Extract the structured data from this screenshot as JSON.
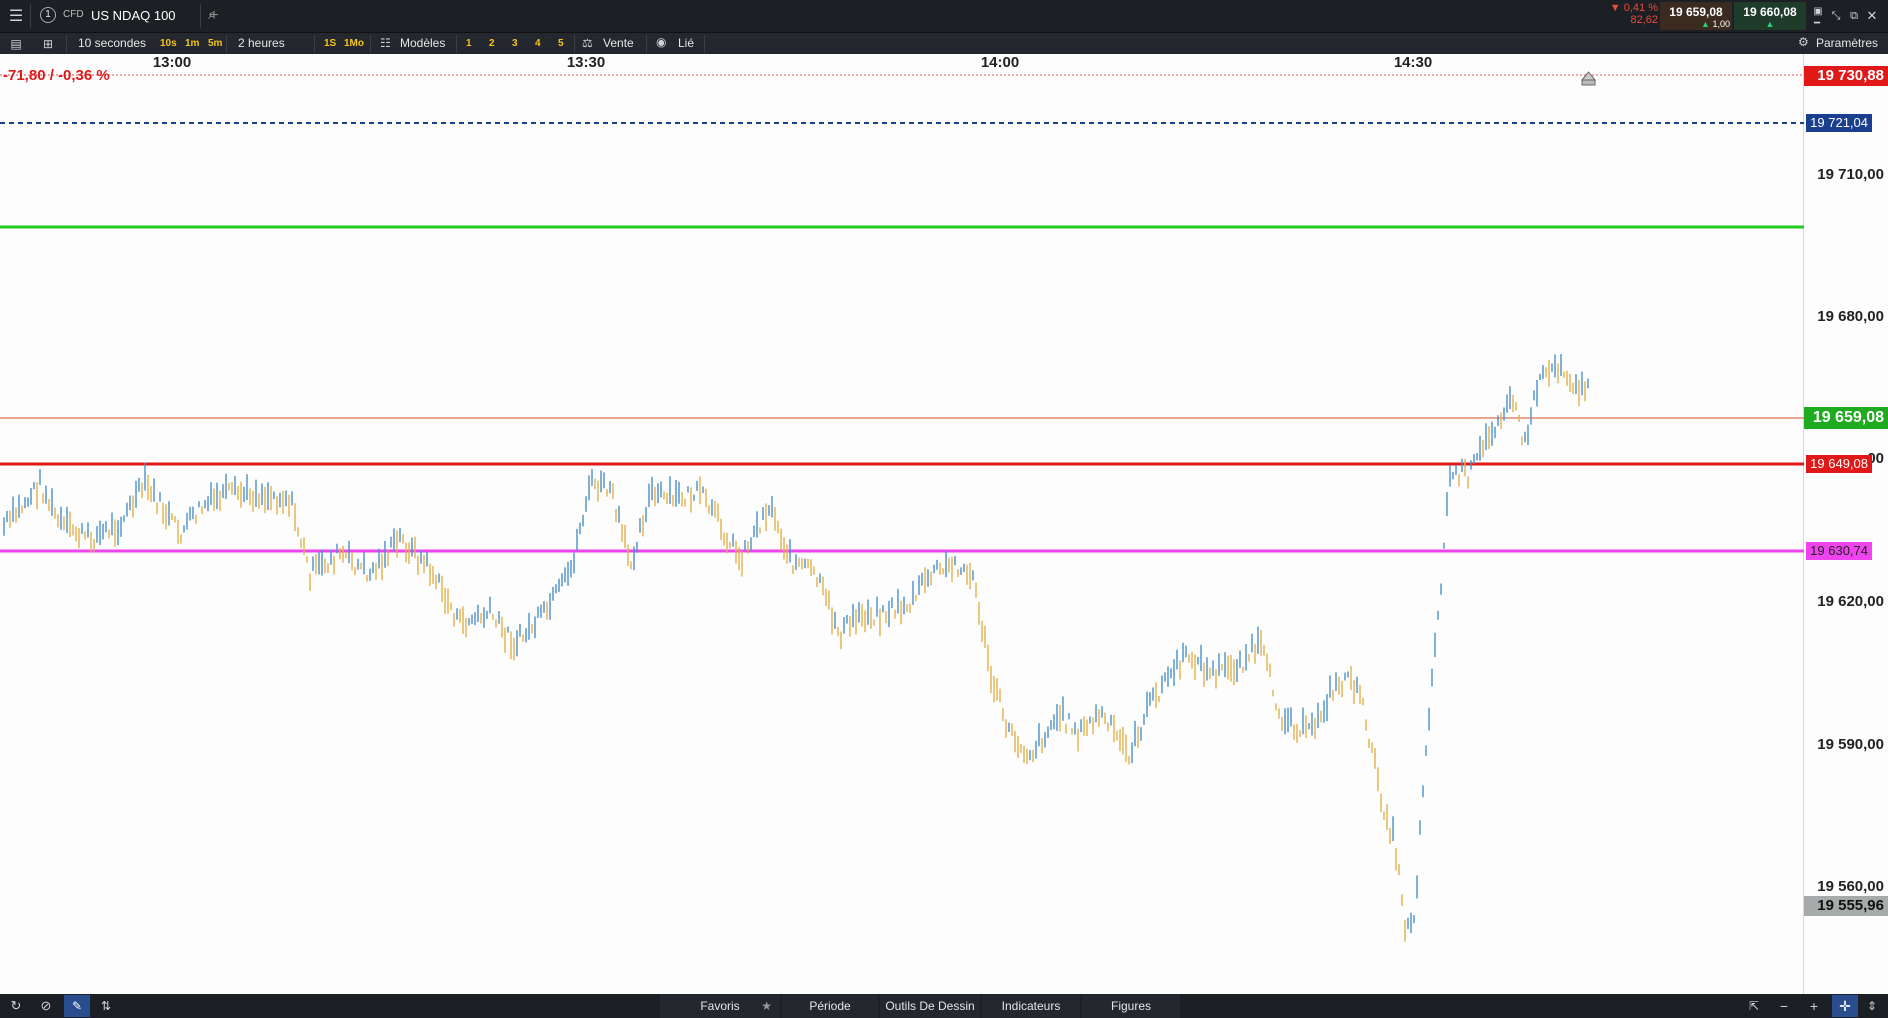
{
  "topbar": {
    "tab_index": "1",
    "instrument_type": "CFD",
    "instrument_name": "US NDAQ 100",
    "change_pct": "▼ 0,41 %",
    "change_pts": "82,62",
    "sell_price": "19 659,08",
    "spread": "1,00",
    "buy_price": "19 660,08"
  },
  "toolbar": {
    "interval": "10 secondes",
    "quick_intervals": [
      "10s",
      "1m",
      "5m"
    ],
    "range": "2 heures",
    "quick_ranges": [
      "1S",
      "1Mo"
    ],
    "templates": "Modèles",
    "slots": [
      "1",
      "2",
      "3",
      "4",
      "5"
    ],
    "trade_mode": "Vente",
    "linked": "Lié",
    "settings": "Paramètres"
  },
  "chart": {
    "change_readout": "-71,80 / -0,36 %",
    "time_labels": [
      "13:00",
      "13:30",
      "14:00",
      "14:30"
    ],
    "axis_labels": [
      "19 710,00",
      "19 680,00",
      "19 620,00",
      "19 590,00",
      "19 560,00"
    ],
    "hidden_label": "00",
    "tags": {
      "high": "19 730,88",
      "blue": "19 721,04",
      "last": "19 659,08",
      "red": "19 649,08",
      "magenta": "19 630,74",
      "low": "19 555,96"
    },
    "colors": {
      "up": "#4a90c8",
      "down": "#e3b04b",
      "green_line": "#22cc22",
      "red_line": "#e01818",
      "magenta_line": "#ee44ee",
      "blue_line": "#1a3f8f",
      "price_line": "#d94b2b"
    }
  },
  "bottombar": {
    "favorites": "Favoris",
    "period": "Période",
    "drawing_tools": "Outils De Dessin",
    "indicators": "Indicateurs",
    "figures": "Figures"
  }
}
